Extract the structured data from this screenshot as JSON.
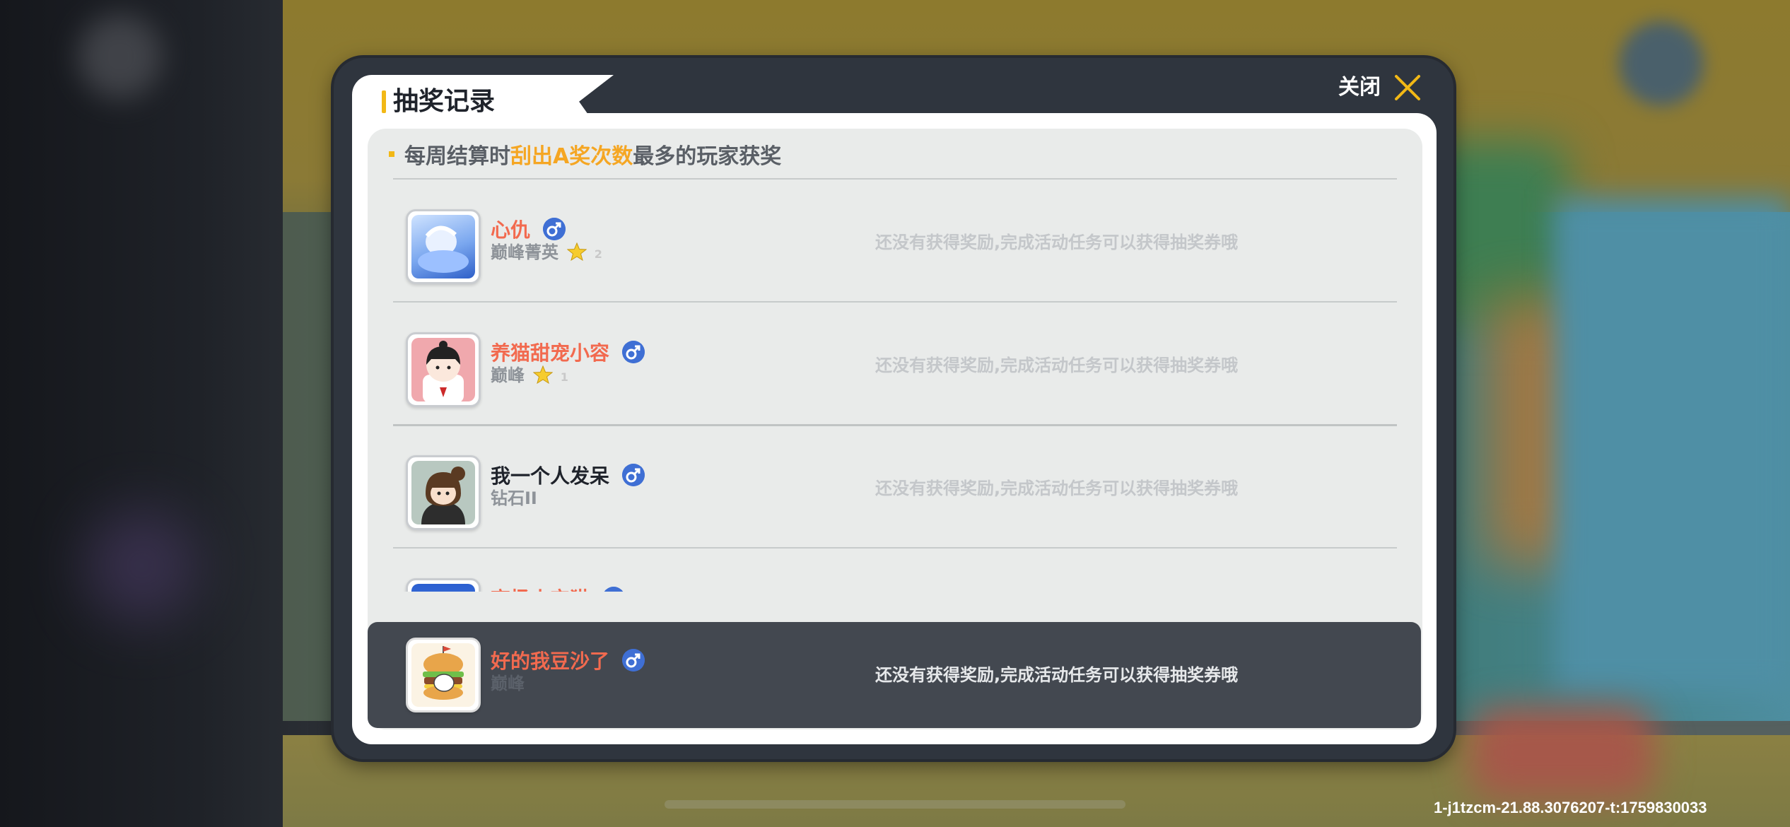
{
  "dialog": {
    "title": "抽奖记录",
    "close_label": "关闭"
  },
  "notice": {
    "prefix": "每周结算时",
    "highlight": "刮出A奖次数",
    "suffix": "最多的玩家获奖"
  },
  "rows": [
    {
      "name": "心仇",
      "name_color": "#f26a4f",
      "rank": "巅峰菁英",
      "stars": "2",
      "status": "还没有获得奖励,完成活动任务可以获得抽奖券哦"
    },
    {
      "name": "养猫甜宠小容",
      "name_color": "#f26a4f",
      "rank": "巅峰",
      "stars": "1",
      "status": "还没有获得奖励,完成活动任务可以获得抽奖券哦"
    },
    {
      "name": "我一个人发呆",
      "name_color": "#1f232b",
      "rank": "钻石II",
      "stars": "",
      "status": "还没有获得奖励,完成活动任务可以获得抽奖券哦"
    },
    {
      "name": "高扬小宝猫",
      "name_color": "#f26a4f",
      "rank": "",
      "stars": "",
      "status": ""
    }
  ],
  "self": {
    "name": "好的我豆沙了",
    "name_color": "#f26a4f",
    "rank": "巅峰",
    "status": "还没有获得奖励,完成活动任务可以获得抽奖券哦"
  },
  "watermark": "1-j1tzcm-21.88.3076207-t:1759830033",
  "colors": {
    "accent": "#f2b816",
    "highlight": "#f5a623",
    "gender": "#3f6fd4"
  }
}
